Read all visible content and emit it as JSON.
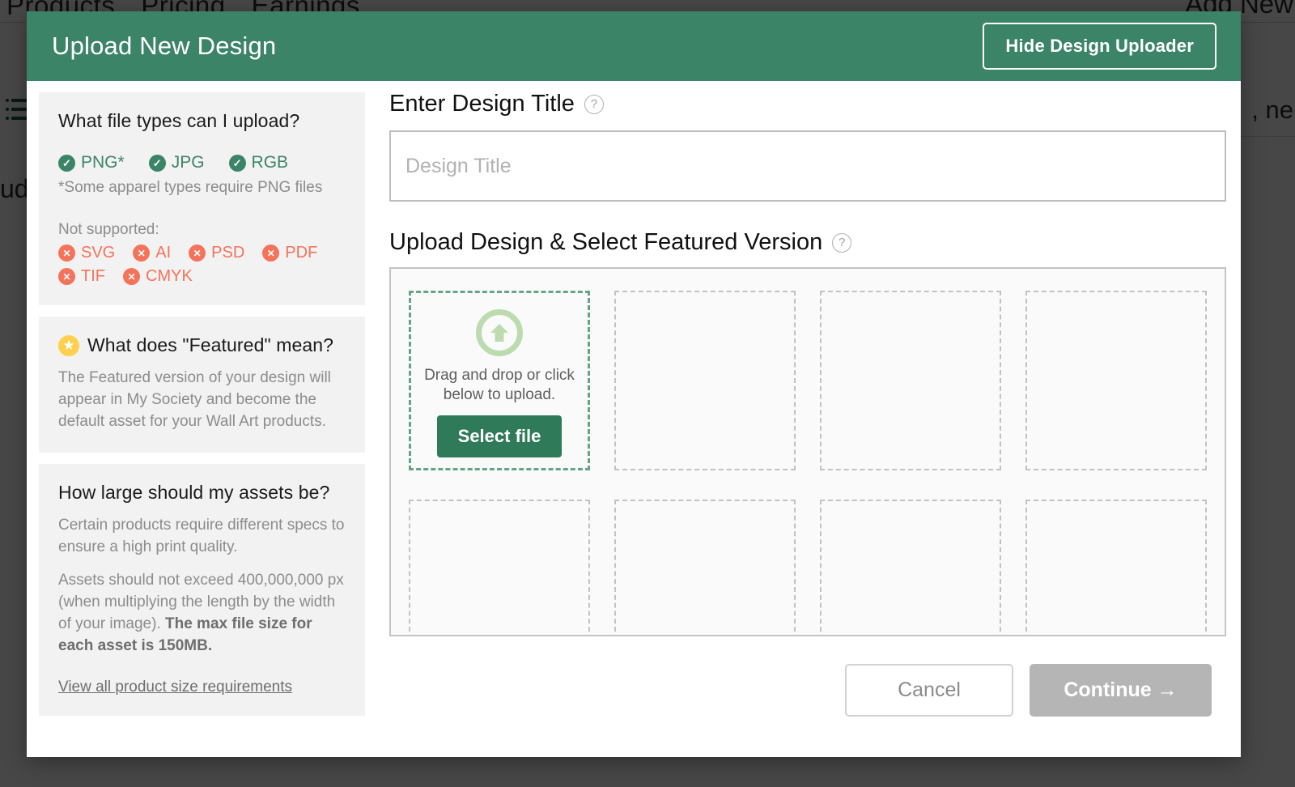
{
  "background": {
    "nav_links": [
      "Products",
      "Pricing",
      "Earnings"
    ],
    "add_new_label": "Add New",
    "left_text": "udi",
    "right_text": ", ne"
  },
  "modal": {
    "title": "Upload New Design",
    "hide_uploader_label": "Hide Design Uploader"
  },
  "info": {
    "filetypes_card": {
      "title": "What file types can I upload?",
      "supported": [
        {
          "icon": "check-circle-icon",
          "label": "PNG*"
        },
        {
          "icon": "check-circle-icon",
          "label": "JPG"
        },
        {
          "icon": "check-circle-icon",
          "label": "RGB"
        }
      ],
      "note": "*Some apparel types require PNG files",
      "not_supported_label": "Not supported:",
      "not_supported_row1": [
        {
          "icon": "x-circle-icon",
          "label": "SVG"
        },
        {
          "icon": "x-circle-icon",
          "label": "AI"
        },
        {
          "icon": "x-circle-icon",
          "label": "PSD"
        },
        {
          "icon": "x-circle-icon",
          "label": "PDF"
        }
      ],
      "not_supported_row2": [
        {
          "icon": "x-circle-icon",
          "label": "TIF"
        },
        {
          "icon": "x-circle-icon",
          "label": "CMYK"
        }
      ]
    },
    "featured_card": {
      "icon": "star-icon",
      "title": "What does \"Featured\" mean?",
      "body": "The Featured version of your design will appear in My Society and become the default asset for your Wall Art products."
    },
    "size_card": {
      "title": "How large should my assets be?",
      "para1": "Certain products require different specs to ensure a high print quality.",
      "para2_prefix": "Assets should not exceed 400,000,000 px (when multiplying the length by the width of your image). ",
      "para2_bold": "The max file size for each asset is 150MB.",
      "link": "View all product size requirements"
    }
  },
  "main": {
    "title_section": {
      "heading": "Enter Design Title",
      "help_icon": "question-circle-icon",
      "input_value": "",
      "input_placeholder": "Design Title"
    },
    "upload_section": {
      "heading": "Upload Design & Select Featured Version",
      "help_icon": "question-circle-icon",
      "dropzone": {
        "icon": "upload-arrow-circle-icon",
        "text": "Drag and drop or click below to upload.",
        "button_label": "Select file"
      },
      "empty_slots": 7
    }
  },
  "footer": {
    "cancel_label": "Cancel",
    "continue_label": "Continue →"
  },
  "colors": {
    "brand_green": "#3c8468",
    "button_green": "#2f7a59",
    "error_orange": "#f4735a",
    "star_yellow": "#ffd04d",
    "disabled_gray": "#b5b5b5"
  }
}
